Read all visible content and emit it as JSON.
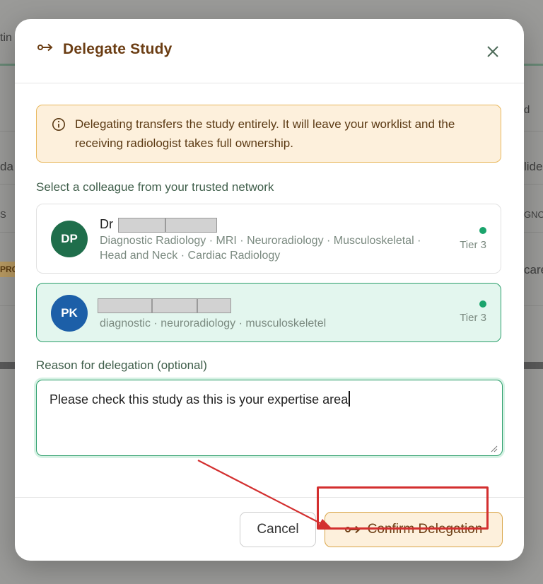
{
  "background": {
    "fragments": [
      "tin",
      "da",
      "lide",
      "d",
      "S",
      "GNO",
      "PRO",
      "care"
    ]
  },
  "modal": {
    "title": "Delegate Study",
    "title_icon": "delegate-arrow-icon",
    "close_icon": "close-icon",
    "notice": {
      "icon": "info-icon",
      "text": "Delegating transfers the study entirely. It will leave your worklist and the receiving radiologist takes full ownership."
    },
    "colleague_section_label": "Select a colleague from your trusted network",
    "colleagues": [
      {
        "initials": "DP",
        "name_prefix": "Dr",
        "specialties": "Diagnostic Radiology · MRI · Neuroradiology · Musculoskeletal · Head and Neck · Cardiac Radiology",
        "tier": "Tier 3",
        "avatar_color": "#1f6e4b",
        "selected": false
      },
      {
        "initials": "PK",
        "name_prefix": "",
        "specialties": "diagnostic · neuroradiology · musculoskeletel",
        "tier": "Tier 3",
        "avatar_color": "#1c5fa8",
        "selected": true
      }
    ],
    "reason_label": "Reason for delegation (optional)",
    "reason_value": "Please check this study as this is your expertise area",
    "buttons": {
      "cancel": "Cancel",
      "confirm": "Confirm Delegation"
    }
  },
  "colors": {
    "accent_brown": "#6b3d13",
    "accent_green": "#2b9e6a",
    "notice_bg": "#fdf0dc",
    "annotation_red": "#d32f2f"
  }
}
